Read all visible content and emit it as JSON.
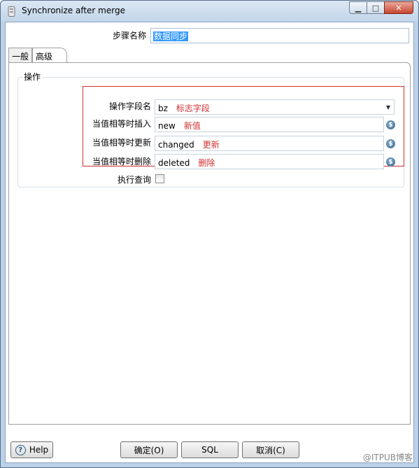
{
  "window": {
    "title": "Synchronize after merge",
    "minimize_icon": "minimize-icon",
    "maximize_icon": "maximize-icon",
    "close_icon": "close-icon"
  },
  "step_name": {
    "label": "步骤名称",
    "value": "数据同步"
  },
  "tabs": [
    {
      "label": "一般",
      "active": false
    },
    {
      "label": "高级",
      "active": true
    }
  ],
  "operation_group": {
    "title": "操作",
    "fields": [
      {
        "label": "操作字段名",
        "value": "bz",
        "annotation": "标志字段"
      },
      {
        "label": "当值相等时插入",
        "value": "new",
        "annotation": "新值"
      },
      {
        "label": "当值相等时更新",
        "value": "changed",
        "annotation": "更新"
      },
      {
        "label": "当值相等时删除",
        "value": "deleted",
        "annotation": "删除"
      }
    ],
    "perform_lookup": {
      "label": "执行查询",
      "checked": false
    }
  },
  "buttons": {
    "help": "Help",
    "ok": "确定(O)",
    "sql": "SQL",
    "cancel": "取消(C)"
  },
  "watermark": "@ITPUB博客",
  "colors": {
    "annotation": "#d03030",
    "selection": "#3399ff",
    "titlebar": "#c2d5ea"
  }
}
